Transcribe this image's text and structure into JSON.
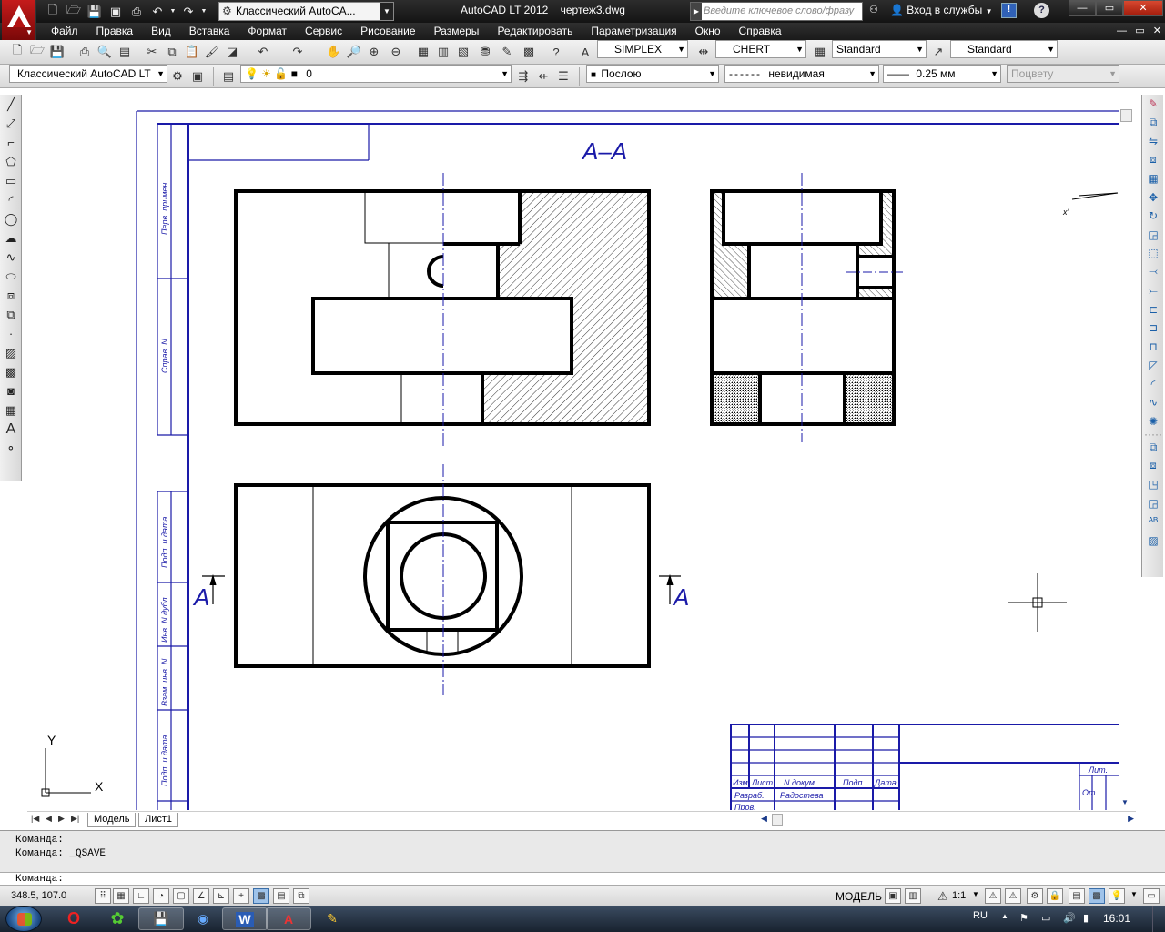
{
  "titlebar": {
    "workspace": "Классический AutoCA...",
    "app_name": "AutoCAD LT 2012",
    "file_name": "чертеж3.dwg",
    "search_placeholder": "Введите ключевое слово/фразу",
    "signin": "Вход в службы"
  },
  "menu": {
    "items": [
      "Файл",
      "Правка",
      "Вид",
      "Вставка",
      "Формат",
      "Сервис",
      "Рисование",
      "Размеры",
      "Редактировать",
      "Параметризация",
      "Окно",
      "Справка"
    ]
  },
  "toolbar1": {
    "text_style": "SIMPLEX",
    "dim_style": "CHERT",
    "table_style": "Standard",
    "mleader_style": "Standard"
  },
  "toolbar2": {
    "workspace": "Классический AutoCAD LT",
    "layer": "0",
    "color": "Послою",
    "linetype": "невидимая",
    "lineweight": "0.25 мм",
    "plotstyle": "Поцвету"
  },
  "drawing": {
    "section_label": "А–А",
    "section_mark_left": "А",
    "section_mark_right": "А",
    "frame_texts": [
      "Перв. примен.",
      "Справ. N",
      "Подп. и дата",
      "Инв. N дубл.",
      "Взам. инв. N",
      "Подп. и дата"
    ],
    "title_block": {
      "col_izm": "Изм.",
      "col_list": "Лист",
      "col_ndoc": "N докум.",
      "col_podp": "Подп.",
      "col_data": "Дата",
      "row_razrab": "Разраб.",
      "razrab_name": "Радостева",
      "row_prov": "Пров.",
      "lit": "Лит.",
      "ot": "От"
    },
    "ucs_x": "X",
    "ucs_y": "Y",
    "leader_x": "x'"
  },
  "tabs": {
    "model": "Модель",
    "sheet": "Лист1"
  },
  "command": {
    "line1": "Команда:",
    "line2": "Команда:  _QSAVE",
    "prompt": "Команда:"
  },
  "status": {
    "coords": "348.5, 107.0",
    "model": "МОДЕЛЬ",
    "scale": "1:1"
  },
  "taskbar": {
    "lang": "RU",
    "time": "16:01"
  }
}
